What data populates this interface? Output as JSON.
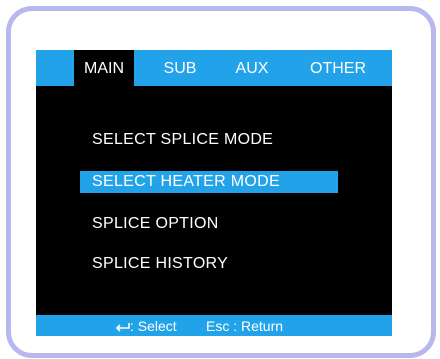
{
  "tabs": [
    {
      "label": "MAIN",
      "active": true
    },
    {
      "label": "SUB",
      "active": false
    },
    {
      "label": "AUX",
      "active": false
    },
    {
      "label": "OTHER",
      "active": false
    }
  ],
  "menu": {
    "items": [
      {
        "label": "SELECT SPLICE MODE",
        "selected": false
      },
      {
        "label": "SELECT HEATER MODE",
        "selected": true
      },
      {
        "label": "SPLICE OPTION",
        "selected": false
      },
      {
        "label": "SPLICE HISTORY",
        "selected": false
      }
    ]
  },
  "footer": {
    "enter_icon": "enter-key-icon",
    "select_hint": ": Select",
    "esc_hint": "Esc : Return"
  },
  "colors": {
    "accent": "#22a3e9",
    "screen_bg": "#000000",
    "bezel": "#b8b8ef",
    "text": "#ffffff"
  }
}
